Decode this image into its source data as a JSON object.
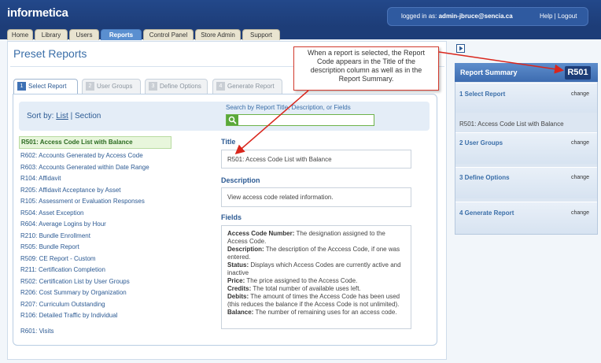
{
  "header": {
    "logo": "informetica",
    "login_prefix": "logged in as:",
    "login_user": "admin-jbruce@sencia.ca",
    "help_logout": "Help | Logout"
  },
  "nav": {
    "tabs": [
      {
        "label": "Home"
      },
      {
        "label": "Library"
      },
      {
        "label": "Users"
      },
      {
        "label": "Reports"
      },
      {
        "label": "Control Panel"
      },
      {
        "label": "Store Admin"
      },
      {
        "label": "Support"
      }
    ],
    "active": "Reports"
  },
  "page": {
    "title": "Preset Reports"
  },
  "steps": [
    {
      "num": "1",
      "label": "Select Report"
    },
    {
      "num": "2",
      "label": "User Groups"
    },
    {
      "num": "3",
      "label": "Define Options"
    },
    {
      "num": "4",
      "label": "Generate Report"
    }
  ],
  "sort": {
    "prefix": "Sort by:",
    "list": "List",
    "separator": "|",
    "section": "Section"
  },
  "search": {
    "label": "Search by Report Title, Description, or Fields",
    "value": ""
  },
  "reports": [
    "R501: Access Code List with Balance",
    "R602: Accounts Generated by Access Code",
    "R603: Accounts Generated within Date Range",
    "R104: Affidavit",
    "R205: Affidavit Acceptance by Asset",
    "R105: Assessment or Evaluation Responses",
    "R504: Asset Exception",
    "R604: Average Logins by Hour",
    "R210: Bundle Enrollment",
    "R505: Bundle Report",
    "R509: CE Report - Custom",
    "R211: Certification Completion",
    "R502: Certification List by User Groups",
    "R206: Cost Summary by Organization",
    "R207: Curriculum Outstanding",
    "R106: Detailed Traffic by Individual",
    "R601: Visits"
  ],
  "detail": {
    "title_label": "Title",
    "title_value": "R501: Access Code List with Balance",
    "description_label": "Description",
    "description_value": "View access code related information.",
    "fields_label": "Fields",
    "fields": [
      {
        "name": "Access Code Number:",
        "text": " The designation assigned to the Access Code."
      },
      {
        "name": "Description:",
        "text": " The description of the Acccess Code, if one was entered."
      },
      {
        "name": "Status:",
        "text": " Displays which Access Codes are currently active and inactive"
      },
      {
        "name": "Price:",
        "text": " The price assigned to the Access Code."
      },
      {
        "name": "Credits:",
        "text": " The total number of available uses left."
      },
      {
        "name": "Debits:",
        "text": " The amount of times the Access Code has been used (this reduces the balance if the Access Code is not unlimited)."
      },
      {
        "name": "Balance:",
        "text": " The number of remaining uses for an access code."
      }
    ]
  },
  "summary": {
    "title": "Report Summary",
    "code": "R501",
    "sections": [
      {
        "label": "1 Select Report",
        "change": "change",
        "detail": "R501: Access Code List with Balance"
      },
      {
        "label": "2 User Groups",
        "change": "change"
      },
      {
        "label": "3 Define Options",
        "change": "change"
      },
      {
        "label": "4 Generate Report",
        "change": "change"
      }
    ]
  },
  "callout": {
    "text": "When a report is selected, the Report Code appears in the Title of the description column as well as in the Report Summary."
  },
  "colors": {
    "header_bg": "#1d3d78",
    "accent": "#3a6ea8",
    "callout_border": "#d23a2e",
    "selection_bg": "#e8f6dc"
  }
}
